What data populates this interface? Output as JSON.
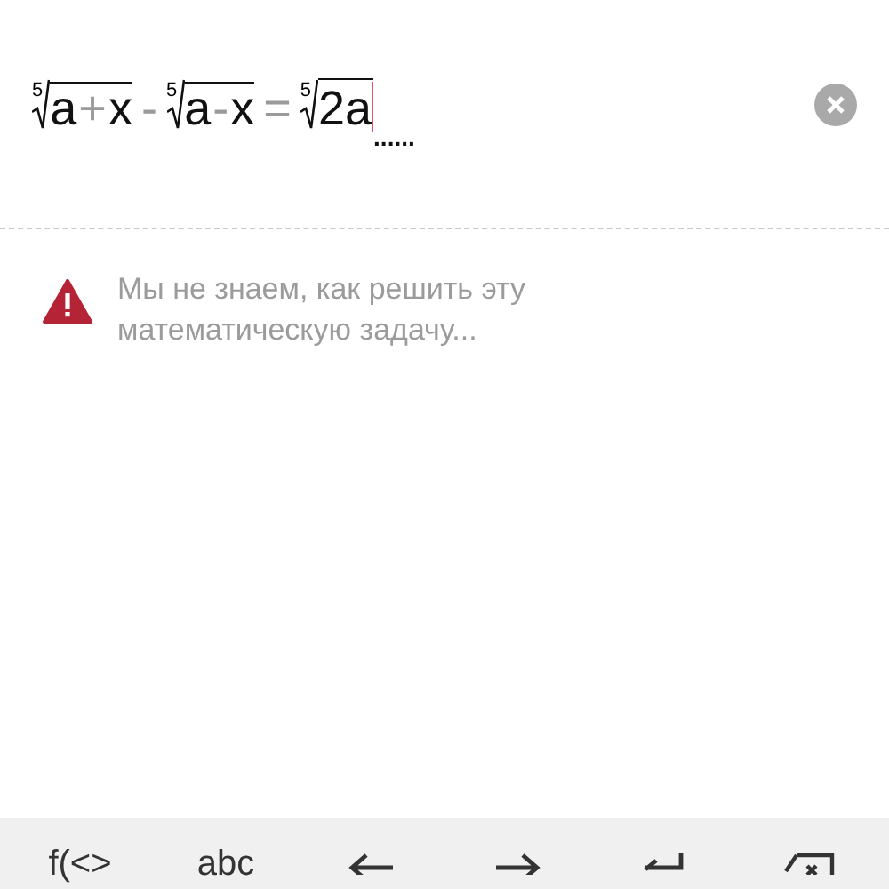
{
  "expression": [
    {
      "kind": "root",
      "index": "5",
      "radicand": [
        {
          "kind": "sym",
          "text": "a"
        },
        {
          "kind": "op",
          "text": "+"
        },
        {
          "kind": "sym",
          "text": "x"
        }
      ],
      "cursor": false
    },
    {
      "kind": "op",
      "text": "-"
    },
    {
      "kind": "root",
      "index": "5",
      "radicand": [
        {
          "kind": "sym",
          "text": "a"
        },
        {
          "kind": "op",
          "text": "-"
        },
        {
          "kind": "sym",
          "text": "x"
        }
      ],
      "cursor": false
    },
    {
      "kind": "op",
      "text": "="
    },
    {
      "kind": "root",
      "index": "5",
      "radicand": [
        {
          "kind": "sym",
          "text": "2a"
        }
      ],
      "cursor": true
    },
    {
      "kind": "placeholder",
      "text": "......"
    }
  ],
  "message": {
    "text": "Мы не знаем, как решить эту математическую задачу..."
  },
  "keyboard_bar": [
    {
      "kind": "text",
      "text": "f(<>"
    },
    {
      "kind": "text",
      "text": "abc"
    },
    {
      "kind": "left"
    },
    {
      "kind": "right"
    },
    {
      "kind": "enter"
    },
    {
      "kind": "backspace"
    }
  ]
}
